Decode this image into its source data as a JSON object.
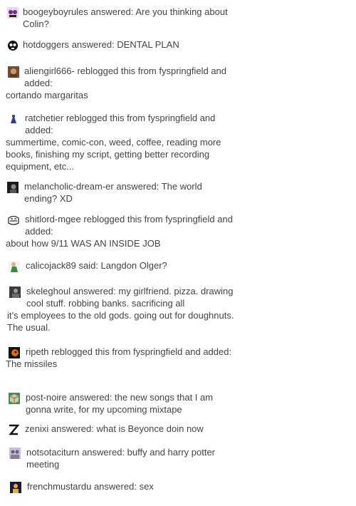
{
  "notes": [
    {
      "user": "boogeyboyrules",
      "action": "answered:",
      "text": "Are you thinking about Colin?",
      "added": ""
    },
    {
      "user": "hotdoggers",
      "action": "answered:",
      "text": "DENTAL PLAN",
      "added": ""
    },
    {
      "user": "aliengirl666-",
      "action": "reblogged this from fyspringfield and added:",
      "text": "",
      "added": "cortando margaritas"
    },
    {
      "user": "ratchetier",
      "action": "reblogged this from fyspringfield and added:",
      "text": "",
      "added": "summertime, comic-con, weed, coffee, reading more books, finishing my script, getting better recording equipment, etc..."
    },
    {
      "user": "melancholic-dream-er",
      "action": "answered:",
      "text": "The world ending? XD",
      "added": ""
    },
    {
      "user": "shitlord-mgee",
      "action": "reblogged this from fyspringfield and added:",
      "text": "",
      "added": "about how 9/11 WAS AN INSIDE JOB"
    },
    {
      "user": "calicojack89",
      "action": "said:",
      "text": "Langdon Olger?",
      "added": ""
    },
    {
      "user": "skeleghoul",
      "action": "answered:",
      "text": "my girlfriend. pizza. drawing cool stuff. robbing banks. sacrificing all",
      "added": "it’s employees to the old gods. going out for doughnuts. The usual."
    },
    {
      "user": "ripeth",
      "action": "reblogged this from fyspringfield and added:",
      "text": "",
      "added": "The missiles"
    },
    {
      "user": "post-noire",
      "action": "answered:",
      "text": "the new songs that I am gonna write, for my upcoming mixtape",
      "added": ""
    },
    {
      "user": "zenixi",
      "action": "answered:",
      "text": "what is Beyonce doin now",
      "added": ""
    },
    {
      "user": "notsotaciturn",
      "action": "answered:",
      "text": "buffy and harry potter meeting",
      "added": ""
    },
    {
      "user": "frenchmustardu",
      "action": "answered:",
      "text": "sex",
      "added": ""
    }
  ],
  "avatar_colors": [
    {
      "bg": "#e8d7ee",
      "fg": "#6b2d8a"
    },
    {
      "bg": "#ffffff",
      "fg": "#111111"
    },
    {
      "bg": "#7a4a2e",
      "fg": "#c79a6b"
    },
    {
      "bg": "#ffffff",
      "fg": "#2a3f88"
    },
    {
      "bg": "#1c1c1c",
      "fg": "#8a8a8a"
    },
    {
      "bg": "#ffffff",
      "fg": "#333333"
    },
    {
      "bg": "#f2f2f2",
      "fg": "#3a8a3a"
    },
    {
      "bg": "#3a3a3a",
      "fg": "#9a9a9a"
    },
    {
      "bg": "#111111",
      "fg": "#e06a1a"
    },
    {
      "bg": "#4a8a5a",
      "fg": "#d8c8a0"
    },
    {
      "bg": "#ffffff",
      "fg": "#111111"
    },
    {
      "bg": "#c8c0d8",
      "fg": "#6a5a7a"
    },
    {
      "bg": "#1a1a3a",
      "fg": "#e0b040"
    }
  ],
  "avatar_icons": [
    "anime-face-avatar-icon",
    "skull-avatar-icon",
    "portrait-avatar-icon",
    "blue-figure-avatar-icon",
    "dark-portrait-avatar-icon",
    "troll-face-avatar-icon",
    "green-figure-avatar-icon",
    "grey-portrait-avatar-icon",
    "orange-creature-avatar-icon",
    "cube-avatar-icon",
    "z-letter-avatar-icon",
    "group-photo-avatar-icon",
    "portrait-avatar-icon"
  ]
}
